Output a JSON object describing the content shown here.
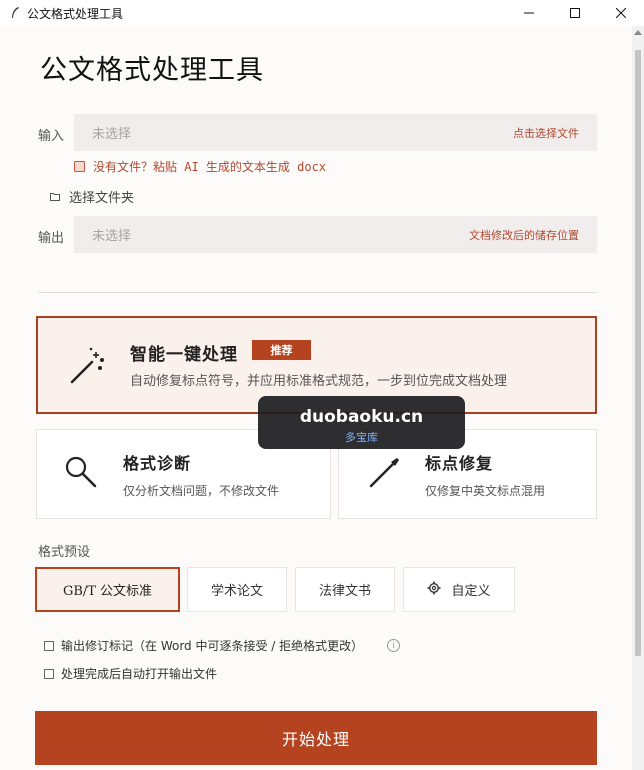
{
  "window": {
    "title": "公文格式处理工具",
    "icon": "quill-icon",
    "controls": [
      "minimize",
      "maximize",
      "close"
    ]
  },
  "header": {
    "title": "公文格式处理工具"
  },
  "input": {
    "label": "输入",
    "placeholder": "未选择",
    "action": "点击选择文件"
  },
  "paste_link": "没有文件？粘贴 AI 生成的文本生成 docx",
  "folder_link": "选择文件夹",
  "output": {
    "label": "输出",
    "placeholder": "未选择",
    "action": "文档修改后的储存位置"
  },
  "hero": {
    "title": "智能一键处理",
    "badge": "推荐",
    "description": "自动修复标点符号，并应用标准格式规范，一步到位完成文档处理"
  },
  "cards": {
    "diagnose": {
      "title": "格式诊断",
      "description": "仅分析文档问题，不修改文件"
    },
    "punctuation": {
      "title": "标点修复",
      "description": "仅修复中英文标点混用"
    }
  },
  "presets": {
    "label": "格式预设",
    "items": [
      "GB/T 公文标准",
      "学术论文",
      "法律文书",
      "自定义"
    ],
    "selected": "GB/T 公文标准"
  },
  "options": {
    "track_changes": "输出修订标记（在 Word 中可逐条接受 / 拒绝格式更改）",
    "auto_open": "处理完成后自动打开输出文件",
    "info_icon": "i"
  },
  "start_button": "开始处理",
  "watermark": {
    "main": "duobaoku.cn",
    "sub": "多宝库"
  },
  "colors": {
    "accent": "#b5431f",
    "hero_bg": "#fbf1ec",
    "input_bg": "#f1eded"
  }
}
